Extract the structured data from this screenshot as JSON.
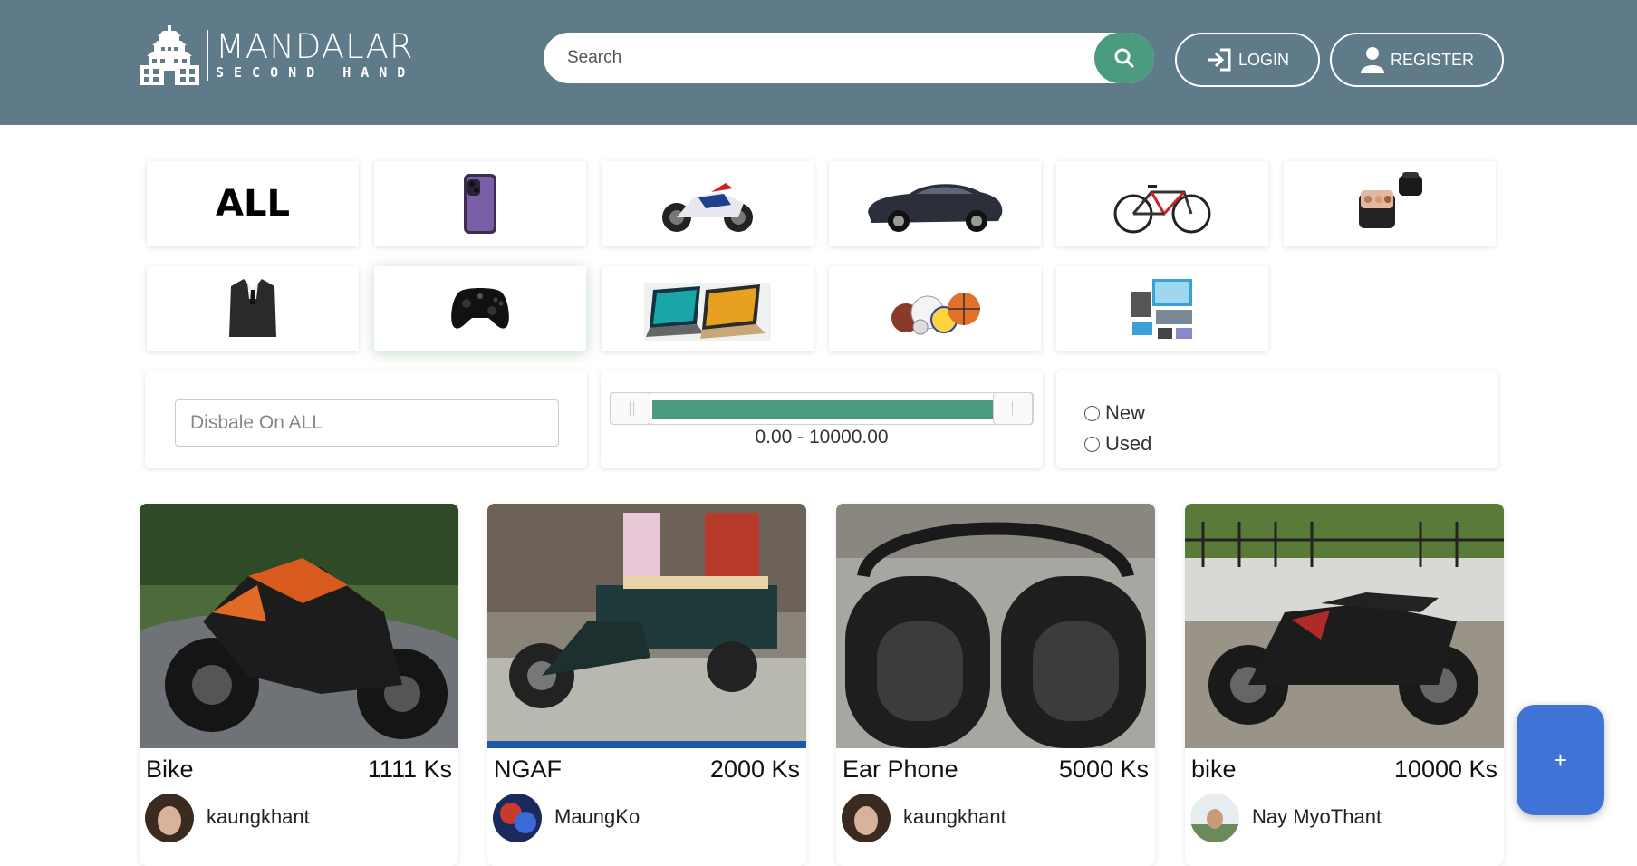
{
  "brand": {
    "name": "MANDALAR",
    "tagline": "SECOND HAND"
  },
  "search": {
    "placeholder": "Search",
    "value": ""
  },
  "header": {
    "login_label": "LOGIN",
    "register_label": "REGISTER"
  },
  "categories": [
    {
      "name": "all",
      "label": "ALL",
      "icon": "all-text"
    },
    {
      "name": "phones",
      "icon": "smartphone-icon"
    },
    {
      "name": "motorbikes",
      "icon": "motorbike-icon"
    },
    {
      "name": "cars",
      "icon": "car-icon"
    },
    {
      "name": "bicycles",
      "icon": "bicycle-icon"
    },
    {
      "name": "cosmetics",
      "icon": "cosmetic-bag-icon"
    },
    {
      "name": "clothing",
      "icon": "suit-icon",
      "active": false
    },
    {
      "name": "gaming",
      "icon": "gamepad-icon",
      "active": true
    },
    {
      "name": "laptops",
      "icon": "laptop-icon"
    },
    {
      "name": "sports",
      "icon": "sports-balls-icon"
    },
    {
      "name": "electronics",
      "icon": "electronics-icon"
    }
  ],
  "filters": {
    "text_placeholder": "Disbale On ALL",
    "price_range_label": "0.00 - 10000.00",
    "price_min": 0,
    "price_max": 10000,
    "condition_options": [
      "New",
      "Used"
    ]
  },
  "products": [
    {
      "title": "Bike",
      "price": "1111 Ks",
      "seller": "kaungkhant"
    },
    {
      "title": "NGAF",
      "price": "2000 Ks",
      "seller": "MaungKo"
    },
    {
      "title": "Ear Phone",
      "price": "5000 Ks",
      "seller": "kaungkhant"
    },
    {
      "title": "bike",
      "price": "10000 Ks",
      "seller": "Nay MyoThant"
    }
  ],
  "fab": {
    "label": "+"
  },
  "colors": {
    "header_bg": "#5f7a88",
    "accent_green": "#4a9b7f",
    "fab_blue": "#3f73d6"
  }
}
